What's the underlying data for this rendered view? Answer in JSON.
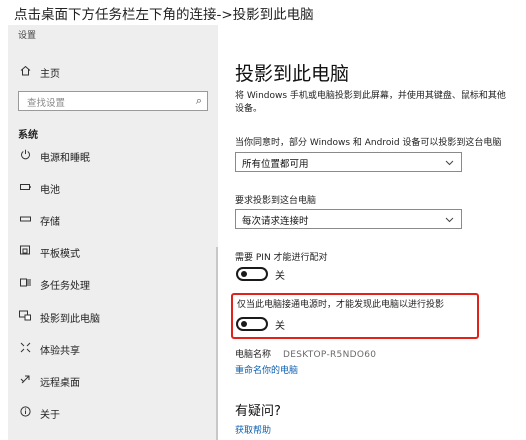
{
  "caption": "点击桌面下方任务栏左下角的连接->投影到此电脑",
  "window": {
    "title": "设置"
  },
  "sidebar": {
    "home": {
      "label": "主页",
      "icon": "home-icon"
    },
    "search": {
      "placeholder": "查找设置",
      "icon": "search-icon"
    },
    "section": "系统",
    "items": [
      {
        "label": "电源和睡眠",
        "icon": "power-icon"
      },
      {
        "label": "电池",
        "icon": "battery-icon"
      },
      {
        "label": "存储",
        "icon": "storage-icon"
      },
      {
        "label": "平板模式",
        "icon": "tablet-mode-icon"
      },
      {
        "label": "多任务处理",
        "icon": "multitasking-icon"
      },
      {
        "label": "投影到此电脑",
        "icon": "project-icon"
      },
      {
        "label": "体验共享",
        "icon": "shared-experiences-icon"
      },
      {
        "label": "远程桌面",
        "icon": "remote-desktop-icon"
      },
      {
        "label": "关于",
        "icon": "info-icon"
      }
    ]
  },
  "main": {
    "title": "投影到此电脑",
    "description_line1": "将 Windows 手机或电脑投影到此屏幕，并使用其键盘、鼠标和其他",
    "description_line2": "设备。",
    "availability": {
      "label": "当你同意时，部分 Windows 和 Android 设备可以投影到这台电脑",
      "value": "所有位置都可用"
    },
    "ask_to_project": {
      "label": "要求投影到这台电脑",
      "value": "每次请求连接时"
    },
    "require_pin": {
      "label": "需要 PIN 才能进行配对",
      "state": "关"
    },
    "power_only": {
      "label": "仅当此电脑接通电源时，才能发现此电脑以进行投影",
      "state": "关"
    },
    "pc_name": {
      "label": "电脑名称",
      "value": "DESKTOP-R5NDO60"
    },
    "rename_link": "重命名你的电脑",
    "help": {
      "title": "有疑问?",
      "link": "获取帮助"
    }
  },
  "colors": {
    "highlight": "#e3211b",
    "link": "#0b5fb0",
    "sidebar_bg": "#eeeeee"
  }
}
